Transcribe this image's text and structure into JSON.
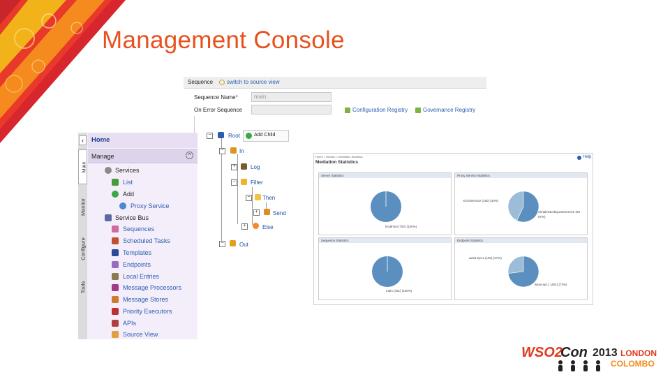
{
  "slide": {
    "title": "Management Console"
  },
  "sequence_editor": {
    "header_label": "Sequence",
    "switch_link": "switch to source view",
    "sequence_name_label": "Sequence Name",
    "required_mark": "*",
    "sequence_name_value": "main",
    "on_error_label": "On Error Sequence",
    "on_error_value": "",
    "config_registry": "Configuration Registry",
    "governance_registry": "Governance Registry",
    "tree": {
      "root": "Root",
      "add_child": "Add Child",
      "in": "In",
      "log": "Log",
      "filter": "Filter",
      "then": "Then",
      "send": "Send",
      "else": "Else",
      "out": "Out"
    }
  },
  "nav": {
    "home": "Home",
    "manage": "Manage",
    "tabs": [
      "Main",
      "Monitor",
      "Configure",
      "Tools"
    ],
    "items": [
      {
        "label": "Services",
        "icon": "services-icon"
      },
      {
        "label": "List",
        "icon": "list-icon"
      },
      {
        "label": "Add",
        "icon": "add-icon"
      },
      {
        "label": "Proxy Service",
        "icon": "proxy-service-icon"
      },
      {
        "label": "Service Bus",
        "icon": "service-bus-icon"
      },
      {
        "label": "Sequences",
        "icon": "sequences-icon"
      },
      {
        "label": "Scheduled Tasks",
        "icon": "scheduled-tasks-icon"
      },
      {
        "label": "Templates",
        "icon": "templates-icon"
      },
      {
        "label": "Endpoints",
        "icon": "endpoints-icon"
      },
      {
        "label": "Local Entries",
        "icon": "local-entries-icon"
      },
      {
        "label": "Message Processors",
        "icon": "message-processors-icon"
      },
      {
        "label": "Message Stores",
        "icon": "message-stores-icon"
      },
      {
        "label": "Priority Executors",
        "icon": "priority-executors-icon"
      },
      {
        "label": "APIs",
        "icon": "apis-icon"
      },
      {
        "label": "Source View",
        "icon": "source-view-icon"
      }
    ]
  },
  "stats": {
    "breadcrumb": "Home > Monitor > Mediation Statistics",
    "help": "Help",
    "title": "Mediation Statistics",
    "panels": [
      {
        "title": "Server Statistics",
        "labels": [
          "localhost (752) (100%)"
        ]
      },
      {
        "title": "Proxy Service Statistics",
        "labels": [
          "EchoService (150) (43%)",
          "SimpleStockQuoteService (20",
          "57%)"
        ]
      },
      {
        "title": "Sequence Statistics",
        "labels": [
          "main (401) (100%)"
        ]
      },
      {
        "title": "Endpoint Statistics",
        "labels": [
          "axis2.epr.1 (150) (27%)",
          "wsas.epr.1 (401) (73%)"
        ]
      }
    ],
    "colors": {
      "main": "#5b8fbf",
      "light": "#9dbcd8"
    },
    "pie_values": [
      [
        {
          "label": "localhost",
          "pct": 100
        }
      ],
      [
        {
          "label": "EchoService",
          "pct": 43
        },
        {
          "label": "SimpleStockQuoteService",
          "pct": 57
        }
      ],
      [
        {
          "label": "main",
          "pct": 100
        }
      ],
      [
        {
          "label": "axis2.epr.1",
          "pct": 27
        },
        {
          "label": "wsas.epr.1",
          "pct": 73
        }
      ]
    ]
  },
  "branding": {
    "wso2": "WSO2",
    "con": "Con",
    "year": "2013",
    "city1": "LONDON",
    "city2": "COLOMBO",
    "colors": {
      "red": "#e03a1e",
      "orange": "#f28c1a",
      "dark": "#222222"
    }
  }
}
